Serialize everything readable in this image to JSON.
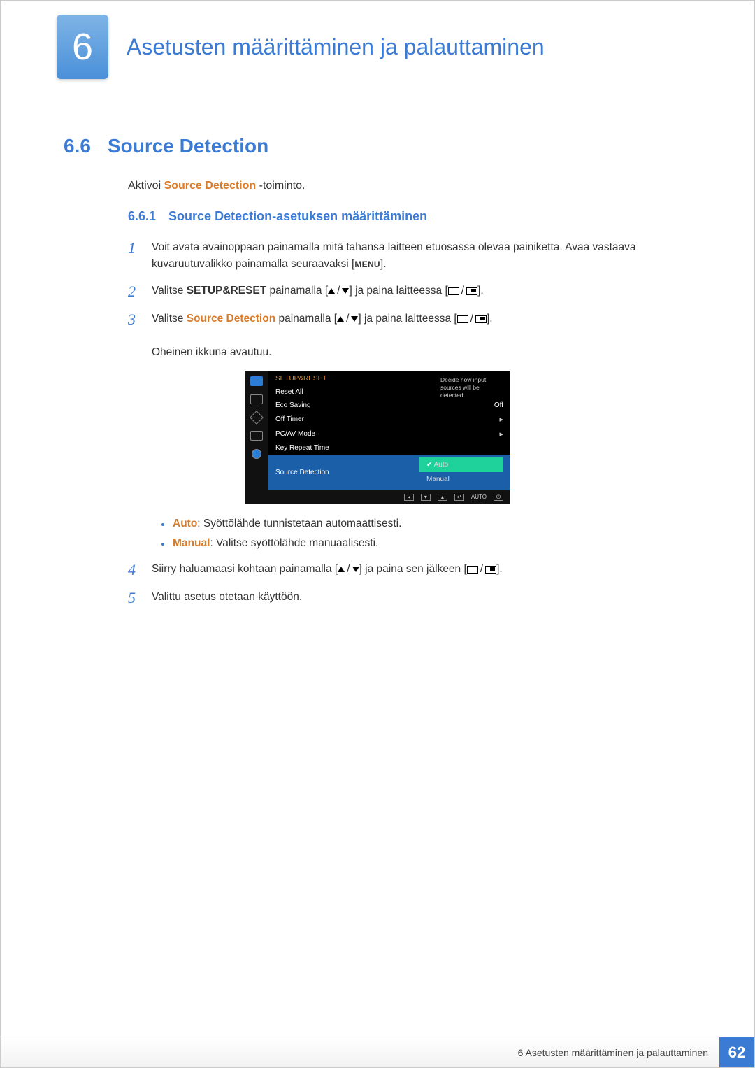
{
  "chapter": {
    "number": "6",
    "title": "Asetusten määrittäminen ja palauttaminen"
  },
  "section": {
    "number": "6.6",
    "title": "Source Detection"
  },
  "intro": {
    "prefix": "Aktivoi ",
    "orange": "Source Detection",
    "suffix": " -toiminto."
  },
  "subsection": {
    "number": "6.6.1",
    "title": "Source Detection-asetuksen määrittäminen"
  },
  "steps": {
    "s1": "Voit avata avainoppaan painamalla mitä tahansa laitteen etuosassa olevaa painiketta. Avaa vastaava kuvaruutuvalikko painamalla seuraavaksi [",
    "s1_menu": "MENU",
    "s1_end": "].",
    "s2a": "Valitse ",
    "s2b": "SETUP&RESET",
    "s2c": " painamalla [",
    "s2d": "] ja paina laitteessa [",
    "s2e": "].",
    "s3a": "Valitse ",
    "s3b": "Source Detection",
    "s3c": " painamalla [",
    "s3d": "] ja paina laitteessa [",
    "s3e": "].",
    "s3f": "Oheinen ikkuna avautuu.",
    "s4a": "Siirry haluamaasi kohtaan painamalla [",
    "s4b": "] ja paina sen jälkeen [",
    "s4c": "].",
    "s5": "Valittu asetus otetaan käyttöön."
  },
  "osd": {
    "title": "SETUP&RESET",
    "rows": {
      "reset": "Reset All",
      "eco": "Eco Saving",
      "eco_val": "Off",
      "off": "Off Timer",
      "pcav": "PC/AV Mode",
      "key": "Key Repeat Time",
      "src": "Source Detection"
    },
    "options": {
      "auto": "Auto",
      "manual": "Manual"
    },
    "desc": "Decide how input sources will be detected.",
    "footer": {
      "auto": "AUTO"
    }
  },
  "bullets": {
    "auto_name": "Auto",
    "auto_text": ": Syöttölähde tunnistetaan automaattisesti.",
    "manual_name": "Manual",
    "manual_text": ": Valitse syöttölähde manuaalisesti."
  },
  "footer": {
    "chap_label": "6 Asetusten määrittäminen ja palauttaminen",
    "page": "62"
  }
}
